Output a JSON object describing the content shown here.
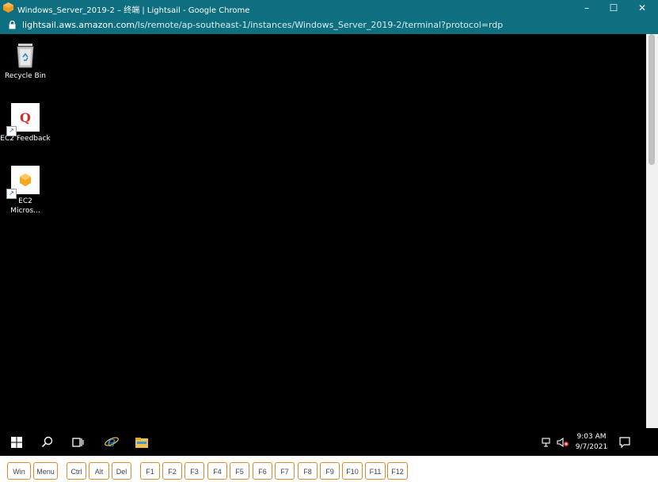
{
  "window": {
    "title": "Windows_Server_2019-2 – 终端 | Lightsail - Google Chrome",
    "minimize": "–",
    "maximize": "☐",
    "close": "✕",
    "accent": "#0e6f80"
  },
  "address": {
    "domain": "lightsail.aws.amazon.com",
    "path": "/ls/remote/ap-southeast-1/instances/Windows_Server_2019-2/terminal?protocol=rdp"
  },
  "desktop_icons": [
    {
      "label": "Recycle Bin",
      "icon": "recycle-bin-icon"
    },
    {
      "label": "EC2 Feedback",
      "icon": "ec2-feedback-icon"
    },
    {
      "label": "EC2 Micros...",
      "icon": "ec2-microsoft-icon"
    }
  ],
  "taskbar": {
    "time": "9:03 AM",
    "date": "9/7/2021",
    "icons": [
      "windows-start-icon",
      "search-icon",
      "task-view-icon",
      "internet-explorer-icon",
      "file-explorer-icon",
      "network-icon",
      "volume-muted-icon",
      "notification-icon"
    ]
  },
  "keys": [
    "Win",
    "Menu",
    "Ctrl",
    "Alt",
    "Del",
    "F1",
    "F2",
    "F3",
    "F4",
    "F5",
    "F6",
    "F7",
    "F8",
    "F9",
    "F10",
    "F11",
    "F12"
  ],
  "colors": {
    "key_border": "#e08a2c",
    "desktop_bg": "#000000"
  }
}
